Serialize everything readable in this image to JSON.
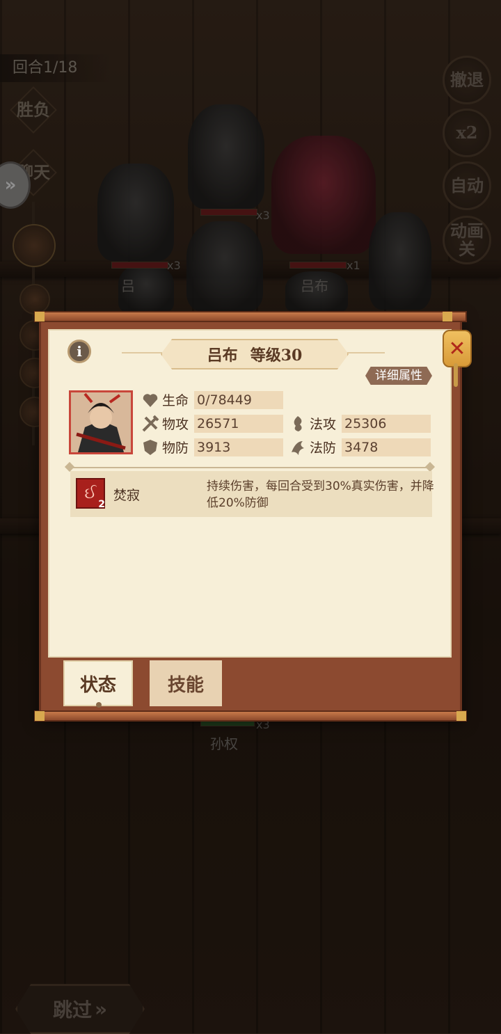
{
  "hud": {
    "round": "回合1/18",
    "left_buttons": [
      "胜负",
      "聊天"
    ],
    "right_buttons": [
      "撤退",
      "x2",
      "自动",
      "动画关"
    ],
    "skip": "跳过"
  },
  "battlefield": {
    "unit_labels": [
      {
        "name": "吕",
        "count": "x3"
      },
      {
        "name": "",
        "count": "x3"
      },
      {
        "name": "吕布",
        "count": "x1"
      },
      {
        "name": "孙权",
        "count": "x3"
      }
    ]
  },
  "panel": {
    "title_name": "吕布",
    "title_level": "等级30",
    "detail_button": "详细属性",
    "stats": [
      {
        "label": "生命",
        "value": "0/78449",
        "icon": "heart-icon"
      },
      {
        "label": "物攻",
        "value": "26571",
        "icon": "physical-attack-icon"
      },
      {
        "label": "法攻",
        "value": "25306",
        "icon": "magic-attack-icon"
      },
      {
        "label": "物防",
        "value": "3913",
        "icon": "physical-defense-icon"
      },
      {
        "label": "法防",
        "value": "3478",
        "icon": "magic-defense-icon"
      }
    ],
    "status_effect": {
      "name": "焚寂",
      "stacks": "2",
      "description": "持续伤害，每回合受到30%真实伤害，并降低20%防御"
    },
    "tabs": [
      "状态",
      "技能"
    ],
    "active_tab": "状态"
  },
  "colors": {
    "panel_frame": "#8c4a30",
    "panel_paper": "#f7efd8",
    "status_icon_red": "#a8201c",
    "close_gold": "#e0aa48"
  }
}
